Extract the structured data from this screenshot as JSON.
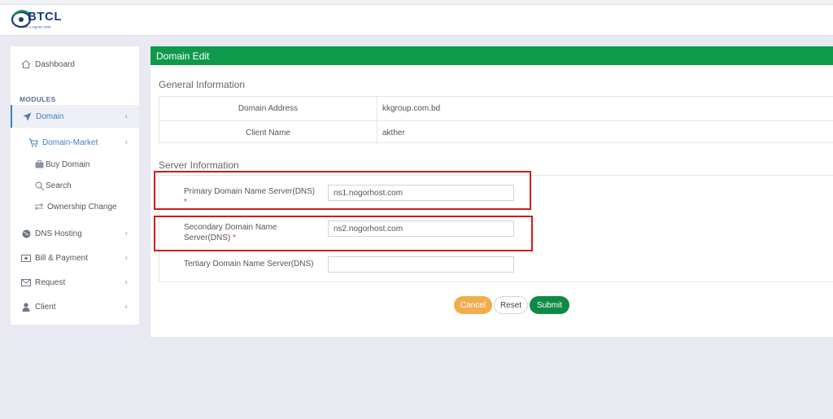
{
  "header": {
    "logo_text": "BTCL",
    "logo_tagline": "দেশ ও মানুষের সেবায়"
  },
  "sidebar": {
    "dashboard": "Dashboard",
    "modules_label": "MODULES",
    "domain": "Domain",
    "domain_market": "Domain-Market",
    "buy_domain": "Buy Domain",
    "search": "Search",
    "ownership_change": "Ownership Change",
    "dns_hosting": "DNS Hosting",
    "bill_payment": "Bill & Payment",
    "request": "Request",
    "client": "Client"
  },
  "panel": {
    "title": "Domain Edit",
    "general_info_title": "General Information",
    "general_info": [
      {
        "label": "Domain Address",
        "value": "kkgroup.com.bd"
      },
      {
        "label": "Client Name",
        "value": "akther"
      }
    ],
    "server_info_title": "Server Information",
    "primary_dns_label": "Primary Domain Name Server(DNS)",
    "primary_dns_value": "ns1.nogorhost.com",
    "secondary_dns_label_line1": "Secondary Domain Name",
    "secondary_dns_label_line2": "Server(DNS)",
    "secondary_dns_value": "ns2.nogorhost.com",
    "tertiary_dns_label": "Tertiary Domain Name Server(DNS)",
    "tertiary_dns_value": "",
    "required_mark": "*"
  },
  "buttons": {
    "cancel": "Cancel",
    "reset": "Reset",
    "submit": "Submit"
  },
  "colors": {
    "panel_header": "#0f9a4b",
    "active_link": "#3f7fc4",
    "highlight": "#d11a1a",
    "cancel_btn": "#f0ad4e",
    "submit_btn": "#0f8a44"
  }
}
